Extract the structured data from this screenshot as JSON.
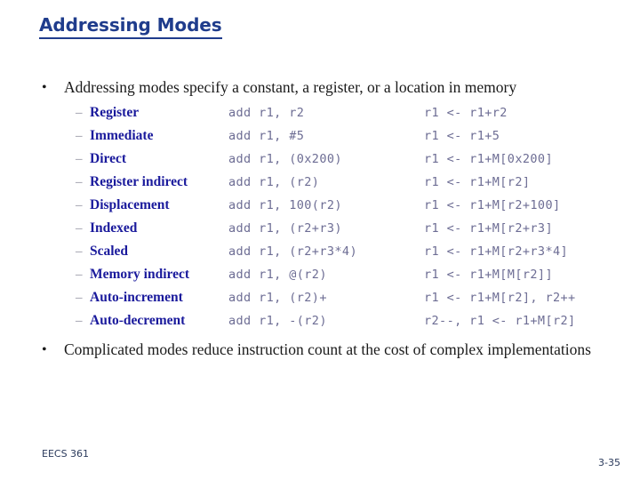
{
  "slide": {
    "title": "Addressing Modes",
    "intro_bullet": "Addressing modes specify a constant, a register, or a location in memory",
    "outro_bullet": "Complicated modes reduce instruction count at the cost of complex implementations",
    "bullet_glyph": "•",
    "sub_bullet_glyph": "–",
    "colors": {
      "title": "#1f3c8c",
      "mode_name": "#1a1a9c",
      "code": "#6d6d94",
      "body_text": "#1a1a1a",
      "footer": "#2b3a5c",
      "background": "#ffffff"
    }
  },
  "modes": [
    {
      "name": "Register",
      "code": "add r1, r2",
      "effect": "r1 <- r1+r2"
    },
    {
      "name": "Immediate",
      "code": "add r1, #5",
      "effect": "r1 <- r1+5"
    },
    {
      "name": "Direct",
      "code": "add r1, (0x200)",
      "effect": "r1 <- r1+M[0x200]"
    },
    {
      "name": "Register indirect",
      "code": "add r1, (r2)",
      "effect": "r1 <- r1+M[r2]"
    },
    {
      "name": "Displacement",
      "code": "add r1, 100(r2)",
      "effect": "r1 <- r1+M[r2+100]"
    },
    {
      "name": "Indexed",
      "code": "add r1, (r2+r3)",
      "effect": "r1 <- r1+M[r2+r3]"
    },
    {
      "name": "Scaled",
      "code": "add r1, (r2+r3*4)",
      "effect": "r1 <- r1+M[r2+r3*4]"
    },
    {
      "name": "Memory indirect",
      "code": "add r1, @(r2)",
      "effect": "r1 <- r1+M[M[r2]]"
    },
    {
      "name": "Auto-increment",
      "code": "add r1, (r2)+",
      "effect": "r1 <- r1+M[r2], r2++"
    },
    {
      "name": "Auto-decrement",
      "code": "add r1, -(r2)",
      "effect": "r2--, r1 <- r1+M[r2]"
    }
  ],
  "footer": {
    "course": "EECS 361",
    "page": "3-35"
  }
}
